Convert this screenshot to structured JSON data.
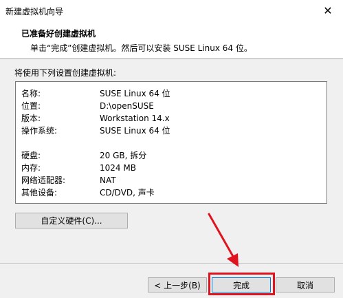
{
  "window": {
    "title": "新建虚拟机向导",
    "close_glyph": "✕"
  },
  "header": {
    "heading": "已准备好创建虚拟机",
    "subheading": "单击“完成”创建虚拟机。然后可以安装 SUSE Linux 64 位。"
  },
  "summary": {
    "intro": "将使用下列设置创建虚拟机:",
    "rows": [
      {
        "key": "名称:",
        "value": "SUSE Linux 64 位"
      },
      {
        "key": "位置:",
        "value": "D:\\openSUSE"
      },
      {
        "key": "版本:",
        "value": "Workstation 14.x"
      },
      {
        "key": "操作系统:",
        "value": "SUSE Linux 64 位"
      },
      {
        "key": "硬盘:",
        "value": "20 GB, 拆分"
      },
      {
        "key": "内存:",
        "value": "1024 MB"
      },
      {
        "key": "网络适配器:",
        "value": "NAT"
      },
      {
        "key": "其他设备:",
        "value": "CD/DVD, 声卡"
      }
    ]
  },
  "buttons": {
    "customize": "自定义硬件(C)...",
    "back": "< 上一步(B)",
    "finish": "完成",
    "cancel": "取消"
  },
  "annotation": {
    "color": "#e0141e"
  }
}
